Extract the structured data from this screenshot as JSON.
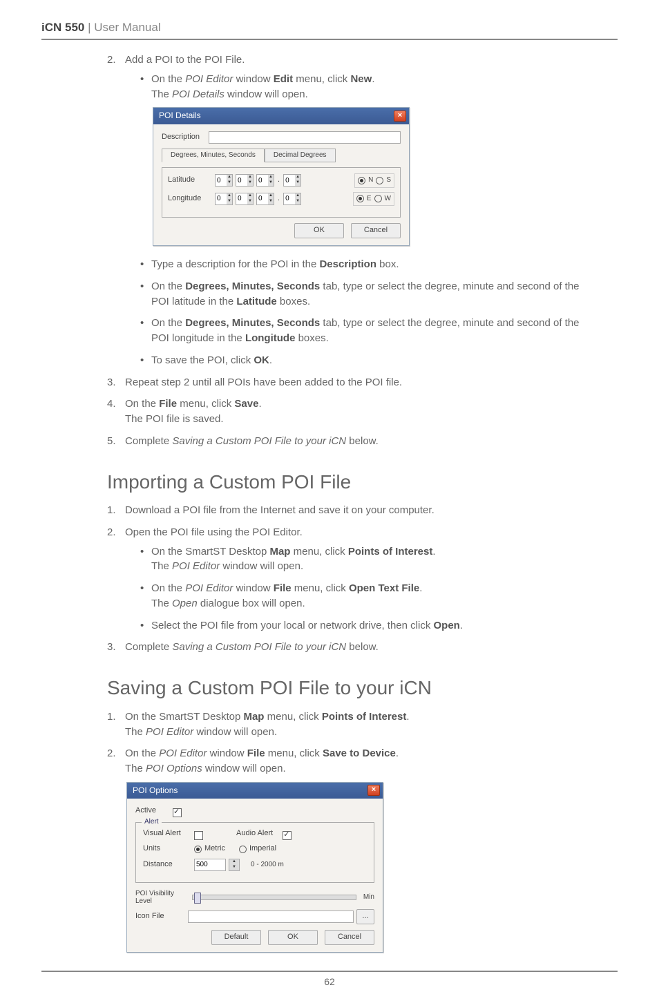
{
  "header": {
    "model": "iCN 550",
    "sep": " | ",
    "title": "User Manual"
  },
  "top": {
    "step2": {
      "num": "2.",
      "text": "Add a POI to the POI File."
    },
    "step2_b1_a": "On the ",
    "step2_b1_italic": "POI Editor",
    "step2_b1_b": " window ",
    "step2_b1_bold1": "Edit",
    "step2_b1_c": " menu, click ",
    "step2_b1_bold2": "New",
    "step2_b1_d": ".",
    "step2_b1_line2a": "The ",
    "step2_b1_line2_italic": "POI Details",
    "step2_b1_line2b": " window will open.",
    "dialog1": {
      "title": "POI Details",
      "desc_label": "Description",
      "tab1": "Degrees, Minutes, Seconds",
      "tab2": "Decimal Degrees",
      "lat_label": "Latitude",
      "lon_label": "Longitude",
      "spin_val": "0",
      "dir_n": "N",
      "dir_s": "S",
      "dir_e": "E",
      "dir_w": "W",
      "ok": "OK",
      "cancel": "Cancel"
    },
    "b2_a": "Type a description for the POI in the ",
    "b2_bold": "Description",
    "b2_c": " box.",
    "b3_a": "On the ",
    "b3_bold1": "Degrees, Minutes, Seconds",
    "b3_b": " tab, type or select the degree, minute and second of the POI latitude in the ",
    "b3_bold2": "Latitude",
    "b3_c": " boxes.",
    "b4_a": "On the ",
    "b4_bold1": "Degrees, Minutes, Seconds",
    "b4_b": " tab, type or select the degree, minute and second of the POI longitude in the ",
    "b4_bold2": "Longitude",
    "b4_c": " boxes.",
    "b5_a": "To save the POI, click ",
    "b5_bold": "OK",
    "b5_b": ".",
    "step3": {
      "num": "3.",
      "text": "Repeat step 2 until all POIs have been added to the POI file."
    },
    "step4": {
      "num": "4.",
      "a": "On the ",
      "bold1": "File",
      "b": " menu, click ",
      "bold2": "Save",
      "c": ".",
      "line2": "The POI file is saved."
    },
    "step5": {
      "num": "5.",
      "a": "Complete ",
      "italic": "Saving a Custom POI File to your iCN",
      "b": " below."
    }
  },
  "importing": {
    "heading": "Importing a Custom POI File",
    "s1": {
      "num": "1.",
      "text": "Download a POI file from the Internet and save it on your computer."
    },
    "s2": {
      "num": "2.",
      "text": "Open the POI file using the POI Editor."
    },
    "s2_b1_a": "On the SmartST Desktop ",
    "s2_b1_bold1": "Map",
    "s2_b1_b": " menu, click ",
    "s2_b1_bold2": "Points of Interest",
    "s2_b1_c": ".",
    "s2_b1_line2a": "The ",
    "s2_b1_line2_italic": "POI Editor",
    "s2_b1_line2b": " window will open.",
    "s2_b2_a": "On the ",
    "s2_b2_italic": "POI Editor",
    "s2_b2_b": " window ",
    "s2_b2_bold1": "File",
    "s2_b2_c": " menu, click ",
    "s2_b2_bold2": "Open Text File",
    "s2_b2_d": ".",
    "s2_b2_line2a": "The ",
    "s2_b2_line2_italic": "Open",
    "s2_b2_line2b": " dialogue box will open.",
    "s2_b3_a": "Select the POI file from your local or network drive, then click ",
    "s2_b3_bold": "Open",
    "s2_b3_b": ".",
    "s3": {
      "num": "3.",
      "a": "Complete ",
      "italic": "Saving a Custom POI File to your iCN",
      "b": " below."
    }
  },
  "saving": {
    "heading": "Saving a Custom POI File to your iCN",
    "s1": {
      "num": "1.",
      "a": "On the SmartST Desktop ",
      "bold1": "Map",
      "b": " menu, click ",
      "bold2": "Points of Interest",
      "c": ".",
      "line2a": "The ",
      "line2_italic": "POI Editor",
      "line2b": " window will open."
    },
    "s2": {
      "num": "2.",
      "a": "On the ",
      "italic1": "POI Editor",
      "b": " window ",
      "bold1": "File",
      "c": " menu, click ",
      "bold2": "Save to Device",
      "d": ".",
      "line2a": "The ",
      "line2_italic": "POI Options",
      "line2b": " window will open."
    },
    "dialog2": {
      "title": "POI Options",
      "active": "Active",
      "alert_legend": "Alert",
      "visual_alert": "Visual Alert",
      "audio_alert": "Audio Alert",
      "units": "Units",
      "metric": "Metric",
      "imperial": "Imperial",
      "distance": "Distance",
      "distance_val": "500",
      "distance_range": "0 - 2000 m",
      "visibility": "POI Visibility Level",
      "vis_min": "Min",
      "icon_file": "Icon File",
      "browse": "...",
      "default": "Default",
      "ok": "OK",
      "cancel": "Cancel"
    }
  },
  "page_number": "62"
}
